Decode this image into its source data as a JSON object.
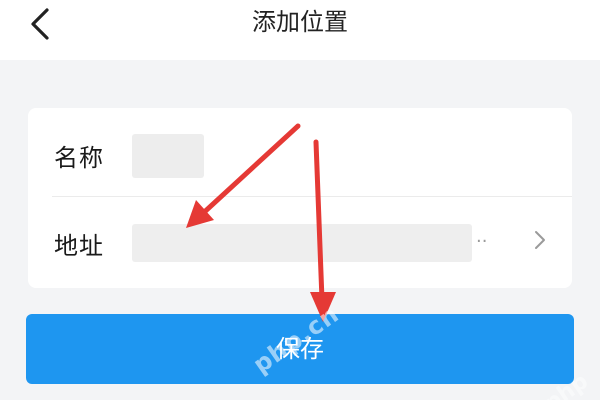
{
  "header": {
    "back_icon": "chevron-left-icon",
    "title": "添加位置"
  },
  "form": {
    "name_label": "名称",
    "address_label": "地址",
    "address_ellipsis": "..",
    "address_chevron_icon": "chevron-right-icon"
  },
  "actions": {
    "save_label": "保存"
  },
  "annotations": {
    "arrow_color": "#e53935",
    "arrow_icon": "red-arrow-icon"
  },
  "watermark": {
    "text": "php.cn",
    "text_2": "php"
  },
  "colors": {
    "primary_button": "#1e96f0",
    "background": "#f3f4f6",
    "card": "#ffffff"
  }
}
